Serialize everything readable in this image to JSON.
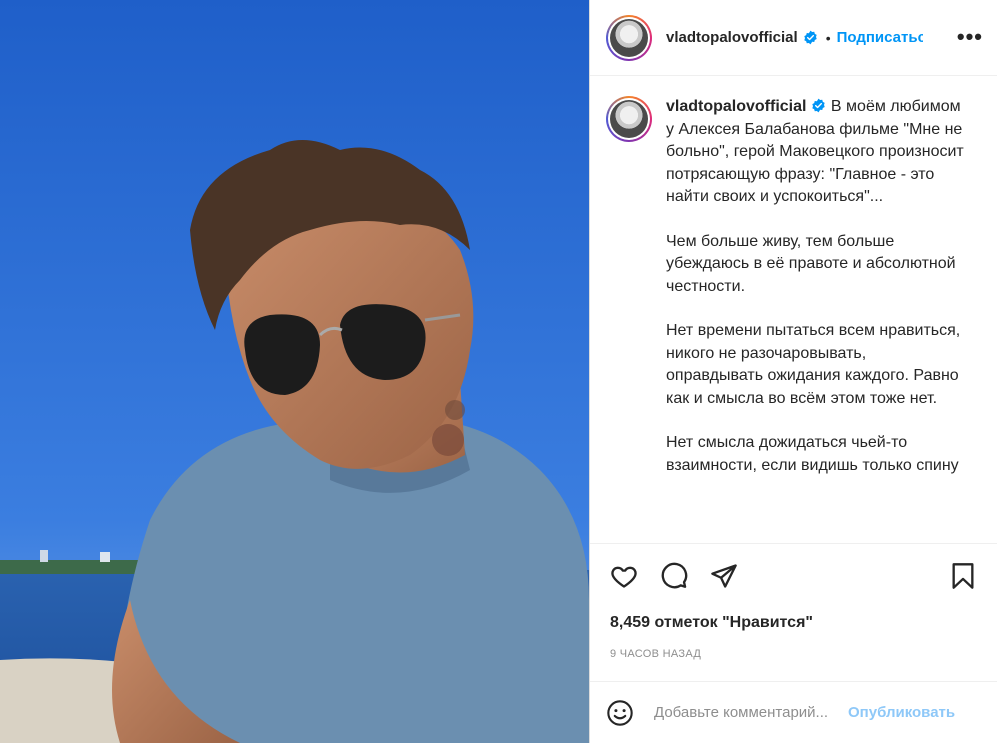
{
  "post": {
    "username": "vladtopalovofficial",
    "follow_label": "Подписаться",
    "dot": "•",
    "more_label": "•••"
  },
  "caption": {
    "username": "vladtopalovofficial",
    "paragraphs": [
      "В моём любимом у Алексея Балабанова фильме \"Мне не больно\", герой Маковецкого произносит потрясающую фразу: \"Главное - это найти своих и успокоиться\"...",
      "Чем больше живу, тем больше убеждаюсь в её правоте и абсолютной честности.",
      "Нет времени пытаться всем нравиться, никого не разочаровывать, оправдывать ожидания каждого. Равно как и смысла во всём этом тоже нет.",
      "Нет смысла дожидаться чьей-то взаимности, если видишь только спину"
    ]
  },
  "stats": {
    "likes": "8,459 отметок \"Нравится\"",
    "time_ago": "9 ЧАСОВ НАЗАД"
  },
  "comment": {
    "placeholder": "Добавьте комментарий...",
    "publish_label": "Опубликовать"
  },
  "icons": {
    "like": "heart-icon",
    "comment": "comment-icon",
    "share": "share-icon",
    "save": "bookmark-icon",
    "emoji": "emoji-icon",
    "verified": "verified-icon"
  },
  "colors": {
    "accent": "#0095f6",
    "publish_disabled": "#8ec8f8",
    "sky": "#2f6ed0",
    "shirt": "#6b8fb0"
  }
}
